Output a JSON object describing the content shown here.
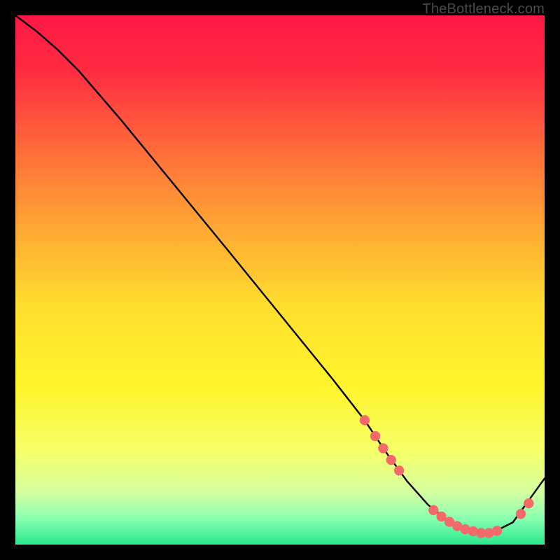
{
  "watermark": "TheBottleneck.com",
  "chart_data": {
    "type": "line",
    "title": "",
    "xlabel": "",
    "ylabel": "",
    "xlim": [
      0,
      100
    ],
    "ylim": [
      0,
      100
    ],
    "gradient_stops": [
      {
        "offset": 0.0,
        "color": "#ff1846"
      },
      {
        "offset": 0.1,
        "color": "#ff2a42"
      },
      {
        "offset": 0.25,
        "color": "#ff6a3a"
      },
      {
        "offset": 0.4,
        "color": "#ffa734"
      },
      {
        "offset": 0.55,
        "color": "#ffde2e"
      },
      {
        "offset": 0.7,
        "color": "#fff52c"
      },
      {
        "offset": 0.82,
        "color": "#f6ff66"
      },
      {
        "offset": 0.9,
        "color": "#d6ffa0"
      },
      {
        "offset": 0.95,
        "color": "#8affb0"
      },
      {
        "offset": 1.0,
        "color": "#28e88f"
      }
    ],
    "series": [
      {
        "name": "bottleneck-curve",
        "x": [
          0,
          4,
          8,
          12,
          20,
          30,
          40,
          50,
          60,
          66,
          70,
          74,
          78,
          82,
          86,
          90,
          94,
          100
        ],
        "y": [
          100,
          97,
          93.5,
          89.5,
          80.2,
          68,
          55.8,
          43.5,
          31.2,
          23.5,
          17.5,
          12,
          7.5,
          4.3,
          2.6,
          2.2,
          4.2,
          12.5
        ]
      }
    ],
    "markers": {
      "name": "highlight-dots",
      "color": "#f46a6a",
      "radius_axis_units": 0.95,
      "points": [
        {
          "x": 66.0,
          "y": 23.5
        },
        {
          "x": 68.0,
          "y": 20.5
        },
        {
          "x": 69.5,
          "y": 18.2
        },
        {
          "x": 71.0,
          "y": 16.0
        },
        {
          "x": 72.5,
          "y": 14.0
        },
        {
          "x": 79.0,
          "y": 6.5
        },
        {
          "x": 80.5,
          "y": 5.3
        },
        {
          "x": 82.0,
          "y": 4.3
        },
        {
          "x": 83.5,
          "y": 3.5
        },
        {
          "x": 85.0,
          "y": 2.9
        },
        {
          "x": 86.5,
          "y": 2.5
        },
        {
          "x": 88.0,
          "y": 2.2
        },
        {
          "x": 89.5,
          "y": 2.2
        },
        {
          "x": 91.0,
          "y": 2.6
        },
        {
          "x": 95.5,
          "y": 5.8
        },
        {
          "x": 97.0,
          "y": 7.8
        }
      ]
    }
  }
}
